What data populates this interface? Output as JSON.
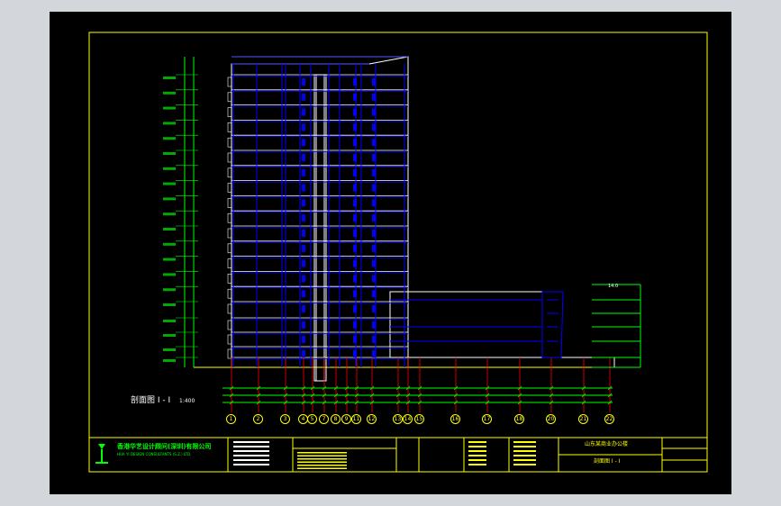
{
  "drawing": {
    "section_label": "剖面图 I - I",
    "section_scale": "1:400",
    "right_level": "14.0",
    "grid_axes": [
      "1",
      "2",
      "3",
      "4",
      "5",
      "7",
      "8",
      "9",
      "11",
      "12",
      "13",
      "14",
      "15",
      "16",
      "17",
      "18",
      "20",
      "21",
      "22"
    ]
  },
  "title_block": {
    "company_cn": "香港华艺设计顾问(深圳)有限公司",
    "company_en": "HUA YI DESIGN CONSULTANTS (S.Z.) LTD.",
    "project_name": "山东某商业办公楼",
    "drawing_title": "剖面图 I - I"
  },
  "colors": {
    "background": "#000000",
    "frame": "#ffff00",
    "walls": "#0000ff",
    "axes": "#ff0000",
    "dimensions": "#00ff00",
    "annotations": "#ffffff",
    "window": "#d3d6db"
  }
}
